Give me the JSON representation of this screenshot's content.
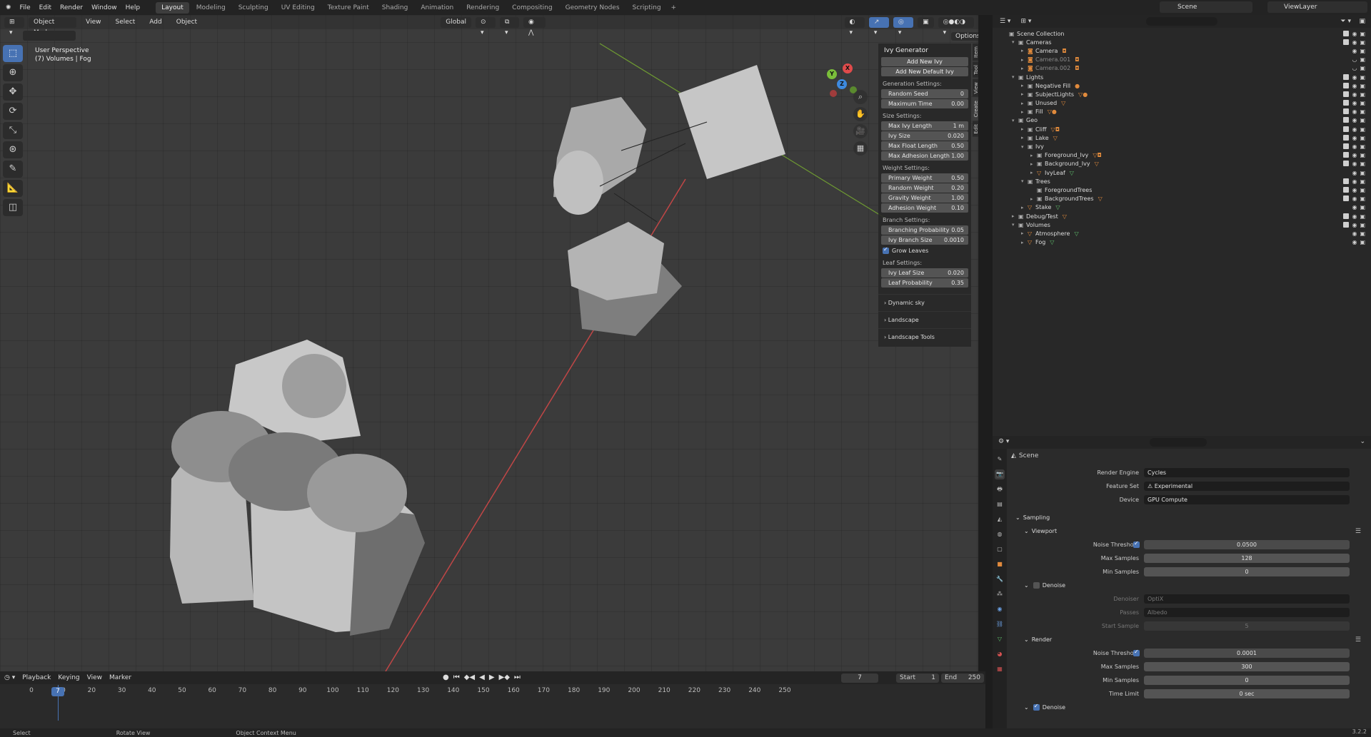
{
  "menubar": {
    "items": [
      "File",
      "Edit",
      "Render",
      "Window",
      "Help"
    ],
    "workspaces": [
      "Layout",
      "Modeling",
      "Sculpting",
      "UV Editing",
      "Texture Paint",
      "Shading",
      "Animation",
      "Rendering",
      "Compositing",
      "Geometry Nodes",
      "Scripting"
    ],
    "active_workspace": "Layout",
    "scene": "Scene",
    "view_layer": "ViewLayer"
  },
  "viewport": {
    "mode": "Object Mode",
    "menus": [
      "View",
      "Select",
      "Add",
      "Object"
    ],
    "orientation": "Global",
    "info_line1": "User Perspective",
    "info_line2": "(7) Volumes | Fog",
    "options": "Options",
    "gizmo": {
      "x": "X",
      "y": "Y",
      "z": "Z"
    },
    "side_tabs": [
      "Item",
      "Tool",
      "View",
      "Create",
      "Edit"
    ]
  },
  "ivy": {
    "title": "Ivy Generator",
    "add_new": "Add New Ivy",
    "add_default": "Add New Default Ivy",
    "sections": [
      {
        "label": "Generation Settings:",
        "fields": [
          {
            "k": "Random Seed",
            "v": "0"
          },
          {
            "k": "Maximum Time",
            "v": "0.00"
          }
        ]
      },
      {
        "label": "Size Settings:",
        "fields": [
          {
            "k": "Max Ivy Length",
            "v": "1 m"
          },
          {
            "k": "Ivy Size",
            "v": "0.020"
          },
          {
            "k": "Max Float Length",
            "v": "0.50"
          },
          {
            "k": "Max Adhesion Length",
            "v": "1.00"
          }
        ]
      },
      {
        "label": "Weight Settings:",
        "fields": [
          {
            "k": "Primary Weight",
            "v": "0.50"
          },
          {
            "k": "Random Weight",
            "v": "0.20"
          },
          {
            "k": "Gravity Weight",
            "v": "1.00"
          },
          {
            "k": "Adhesion Weight",
            "v": "0.10"
          }
        ]
      },
      {
        "label": "Branch Settings:",
        "fields": [
          {
            "k": "Branching Probability",
            "v": "0.05"
          },
          {
            "k": "Ivy Branch Size",
            "v": "0.0010"
          }
        ]
      }
    ],
    "grow_leaves": "Grow Leaves",
    "leaf_label": "Leaf Settings:",
    "leaf_fields": [
      {
        "k": "Ivy Leaf Size",
        "v": "0.020"
      },
      {
        "k": "Leaf Probability",
        "v": "0.35"
      }
    ],
    "collapsed": [
      "Dynamic sky",
      "Landscape",
      "Landscape Tools"
    ]
  },
  "timeline": {
    "menus": [
      "Playback",
      "Keying",
      "View",
      "Marker"
    ],
    "current_frame": "7",
    "start_label": "Start",
    "start": "1",
    "end_label": "End",
    "end": "250",
    "ticks": [
      "0",
      "10",
      "20",
      "30",
      "40",
      "50",
      "60",
      "70",
      "80",
      "90",
      "100",
      "110",
      "120",
      "130",
      "140",
      "150",
      "160",
      "170",
      "180",
      "190",
      "200",
      "210",
      "220",
      "230",
      "240",
      "250"
    ],
    "playhead": "7"
  },
  "statusbar": {
    "select": "Select",
    "rotate": "Rotate View",
    "context": "Object Context Menu",
    "version": "3.2.2"
  },
  "outliner": {
    "rows": [
      {
        "name": "Scene Collection",
        "indent": 0,
        "type": "col",
        "arrow": ""
      },
      {
        "name": "Cameras",
        "indent": 1,
        "type": "col",
        "arrow": "▾"
      },
      {
        "name": "Camera",
        "indent": 2,
        "type": "cam",
        "arrow": "▸",
        "badge": "◘"
      },
      {
        "name": "Camera.001",
        "indent": 2,
        "type": "cam",
        "arrow": "▸",
        "dim": true,
        "badge": "◘"
      },
      {
        "name": "Camera.002",
        "indent": 2,
        "type": "cam",
        "arrow": "▸",
        "dim": true,
        "badge": "◘"
      },
      {
        "name": "Lights",
        "indent": 1,
        "type": "col",
        "arrow": "▾"
      },
      {
        "name": "Negative Fill",
        "indent": 2,
        "type": "col",
        "arrow": "▸",
        "badge": "●"
      },
      {
        "name": "SubjectLights",
        "indent": 2,
        "type": "col",
        "arrow": "▸",
        "badge": "▽●"
      },
      {
        "name": "Unused",
        "indent": 2,
        "type": "col",
        "arrow": "▸",
        "badge": "▽"
      },
      {
        "name": "Fill",
        "indent": 2,
        "type": "col",
        "arrow": "▸",
        "badge": "▽●"
      },
      {
        "name": "Geo",
        "indent": 1,
        "type": "col",
        "arrow": "▾"
      },
      {
        "name": "Cliff",
        "indent": 2,
        "type": "col",
        "arrow": "▸",
        "badge": "▽◘"
      },
      {
        "name": "Lake",
        "indent": 2,
        "type": "col",
        "arrow": "▸",
        "badge": "▽"
      },
      {
        "name": "Ivy",
        "indent": 2,
        "type": "col",
        "arrow": "▾"
      },
      {
        "name": "Foreground_Ivy",
        "indent": 3,
        "type": "col",
        "arrow": "▸",
        "badge": "▽◘"
      },
      {
        "name": "Background_Ivy",
        "indent": 3,
        "type": "col",
        "arrow": "▸",
        "badge": "▽"
      },
      {
        "name": "IvyLeaf",
        "indent": 3,
        "type": "obj",
        "arrow": "▸",
        "badge": "▽",
        "green": true
      },
      {
        "name": "Trees",
        "indent": 2,
        "type": "col",
        "arrow": "▾"
      },
      {
        "name": "ForegroundTrees",
        "indent": 3,
        "type": "col",
        "arrow": ""
      },
      {
        "name": "BackgroundTrees",
        "indent": 3,
        "type": "col",
        "arrow": "▸",
        "badge": "▽"
      },
      {
        "name": "Stake",
        "indent": 2,
        "type": "obj",
        "arrow": "▸",
        "badge": "▽",
        "green": true
      },
      {
        "name": "Debug/Test",
        "indent": 1,
        "type": "col",
        "arrow": "▸",
        "badge": "▽"
      },
      {
        "name": "Volumes",
        "indent": 1,
        "type": "col",
        "arrow": "▾"
      },
      {
        "name": "Atmosphere",
        "indent": 2,
        "type": "obj",
        "arrow": "▸",
        "badge": "▽",
        "green": true
      },
      {
        "name": "Fog",
        "indent": 2,
        "type": "obj",
        "arrow": "▸",
        "badge": "▽",
        "green": true
      }
    ]
  },
  "properties": {
    "scene": "Scene",
    "render_engine": {
      "label": "Render Engine",
      "value": "Cycles"
    },
    "feature_set": {
      "label": "Feature Set",
      "value": "Experimental"
    },
    "device": {
      "label": "Device",
      "value": "GPU Compute"
    },
    "sampling": "Sampling",
    "viewport": {
      "title": "Viewport",
      "noise_threshold": {
        "label": "Noise Threshold",
        "value": "0.0500"
      },
      "max_samples": {
        "label": "Max Samples",
        "value": "128"
      },
      "min_samples": {
        "label": "Min Samples",
        "value": "0"
      }
    },
    "denoise": "Denoise",
    "denoiser": {
      "label": "Denoiser",
      "value": "OptiX"
    },
    "passes": {
      "label": "Passes",
      "value": "Albedo"
    },
    "start_sample": {
      "label": "Start Sample",
      "value": "5"
    },
    "render": {
      "title": "Render",
      "noise_threshold": {
        "label": "Noise Threshold",
        "value": "0.0001"
      },
      "max_samples": {
        "label": "Max Samples",
        "value": "300"
      },
      "min_samples": {
        "label": "Min Samples",
        "value": "0"
      },
      "time_limit": {
        "label": "Time Limit",
        "value": "0 sec"
      }
    },
    "denoise2": "Denoise"
  }
}
